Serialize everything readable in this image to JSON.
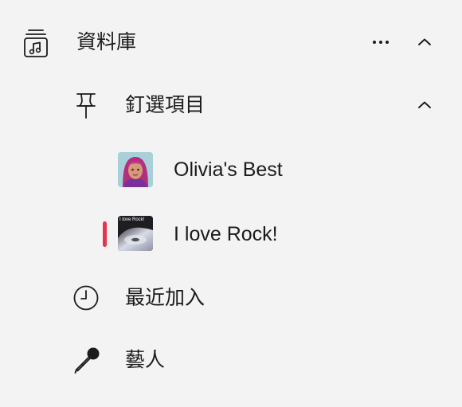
{
  "library": {
    "label": "資料庫",
    "icon": "music-library-icon",
    "more_icon": "more-icon",
    "collapse_icon": "chevron-up-icon"
  },
  "pinned": {
    "label": "釘選項目",
    "icon": "pin-icon",
    "collapse_icon": "chevron-up-icon"
  },
  "pinned_items": [
    {
      "label": "Olivia's Best",
      "thumb_icon": "playlist-artwork",
      "selected": false
    },
    {
      "label": "I love Rock!",
      "thumb_icon": "playlist-artwork",
      "thumb_text": "I love Rock!",
      "selected": true
    }
  ],
  "recent": {
    "label": "最近加入",
    "icon": "clock-icon"
  },
  "artists": {
    "label": "藝人",
    "icon": "microphone-icon"
  },
  "colors": {
    "accent": "#e8334d",
    "background": "#f3f3f3"
  }
}
